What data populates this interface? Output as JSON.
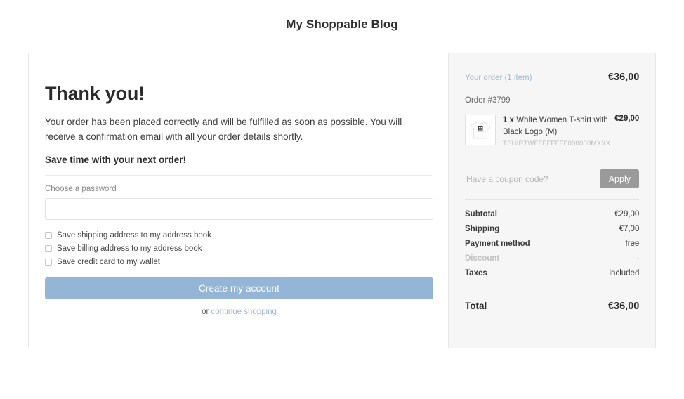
{
  "header": {
    "title": "My Shoppable Blog"
  },
  "main": {
    "heading": "Thank you!",
    "intro": "Your order has been placed correctly and will be fulfilled as soon as possible. You will receive a confirmation email with all your order details shortly.",
    "save_time_heading": "Save time with your next order!",
    "password_label": "Choose a password",
    "password_value": "",
    "password_placeholder": "",
    "checkboxes": [
      {
        "label": "Save shipping address to my address book",
        "checked": false
      },
      {
        "label": "Save billing address to my address book",
        "checked": false
      },
      {
        "label": "Save credit card to my wallet",
        "checked": false
      }
    ],
    "create_account_label": "Create my account",
    "or_text": "or",
    "continue_shopping_label": "continue shopping"
  },
  "summary": {
    "order_link_label": "Your order (1 item)",
    "order_total_top": "€36,00",
    "order_number": "Order #3799",
    "items": [
      {
        "quantity_prefix": "1 x",
        "name": "White Women T-shirt with Black Logo (M)",
        "sku": "TSHIRTWFFFFFFFF000000MXXX",
        "price": "€29,00"
      }
    ],
    "coupon_placeholder": "Have a coupon code?",
    "coupon_value": "",
    "apply_label": "Apply",
    "totals": [
      {
        "label": "Subtotal",
        "value": "€29,00",
        "muted": false
      },
      {
        "label": "Shipping",
        "value": "€7,00",
        "muted": false
      },
      {
        "label": "Payment method",
        "value": "free",
        "muted": false
      },
      {
        "label": "Discount",
        "value": "-",
        "muted": true
      },
      {
        "label": "Taxes",
        "value": "included",
        "muted": false
      }
    ],
    "grand_total_label": "Total",
    "grand_total_value": "€36,00"
  },
  "colors": {
    "accent_button": "#94b5d6",
    "apply_button": "#9a9a9a",
    "link": "#9fb8cf",
    "panel_bg": "#f6f6f6",
    "border": "#e6e6e6"
  }
}
